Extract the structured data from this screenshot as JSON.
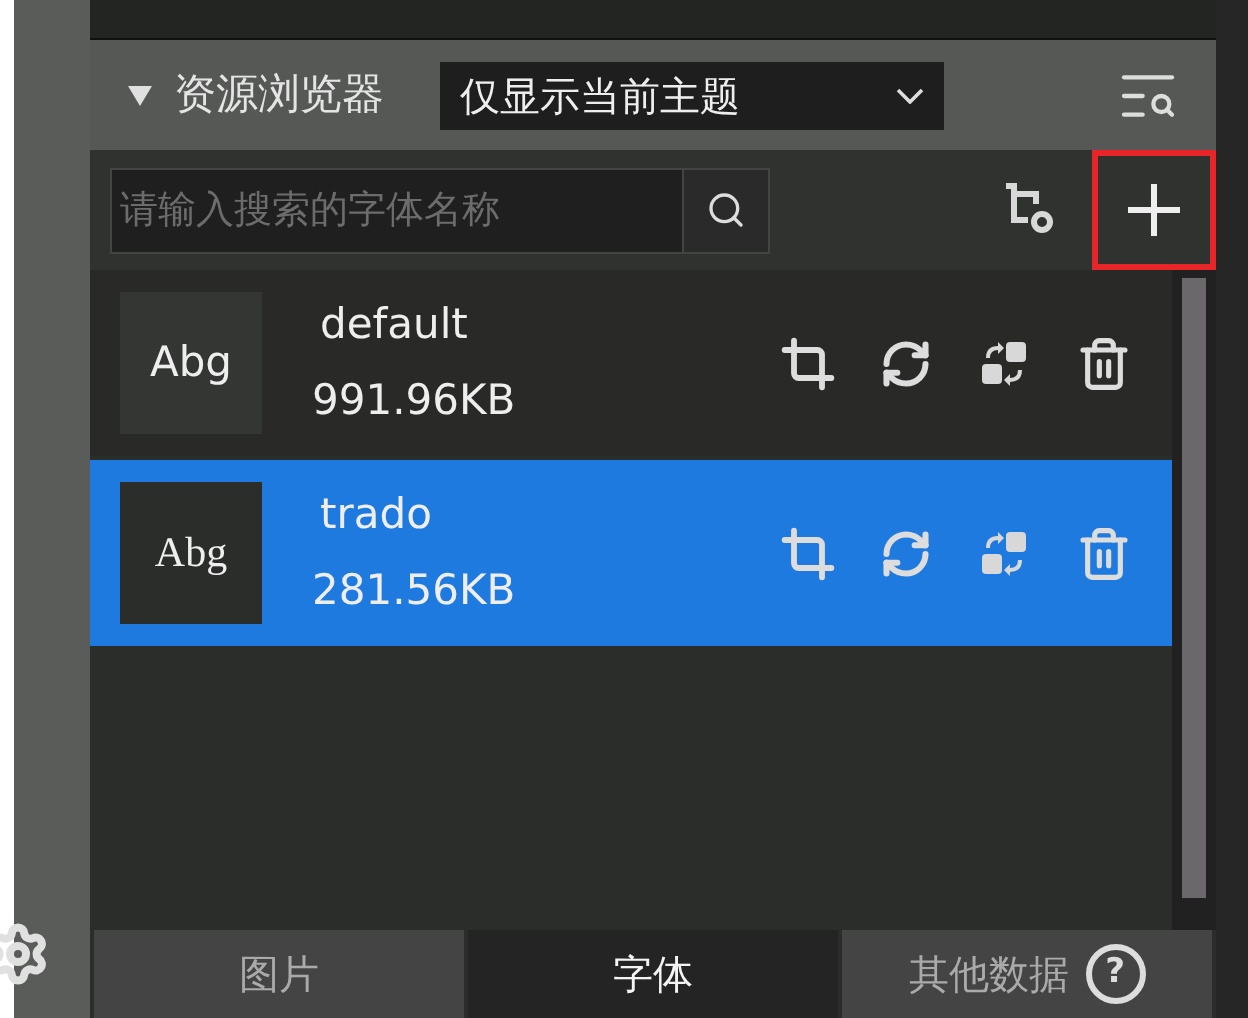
{
  "panel": {
    "title": "资源浏览器",
    "expanded": true,
    "filter": {
      "value": "仅显示当前主题"
    }
  },
  "search": {
    "placeholder": "请输入搜索的字体名称"
  },
  "add_button": {
    "highlighted": true
  },
  "fonts": [
    {
      "preview": "Abg",
      "kind": "sans",
      "name": "default",
      "size": "991.96KB",
      "selected": false
    },
    {
      "preview": "Abg",
      "kind": "serif",
      "name": "trado",
      "size": "281.56KB",
      "selected": true
    }
  ],
  "tabs": [
    {
      "label": "图片",
      "selected": false
    },
    {
      "label": "字体",
      "selected": true
    },
    {
      "label": "其他数据",
      "selected": false,
      "help": "?"
    }
  ]
}
